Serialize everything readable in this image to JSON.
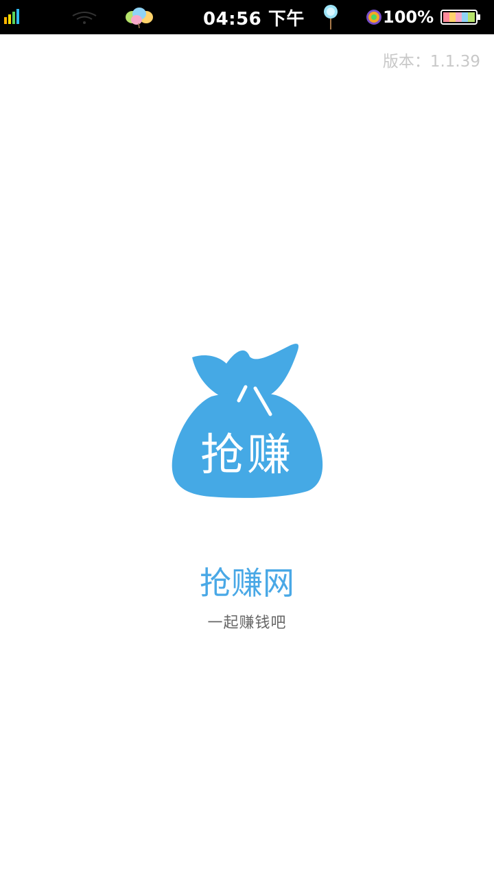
{
  "status_bar": {
    "time": "04:56 下午",
    "battery_percent": "100%",
    "icons": [
      "signal-icon",
      "wifi-icon",
      "balloons-icon",
      "lollipop-icon",
      "alarm-icon",
      "battery-icon"
    ]
  },
  "splash": {
    "version": "版本：1.1.39",
    "logo_text": "抢赚",
    "app_name": "抢赚网",
    "tagline": "一起赚钱吧"
  },
  "colors": {
    "brand": "#45a9e5",
    "status_bg": "#000000",
    "version_text": "#c8c8c8",
    "tagline_text": "#666666"
  }
}
